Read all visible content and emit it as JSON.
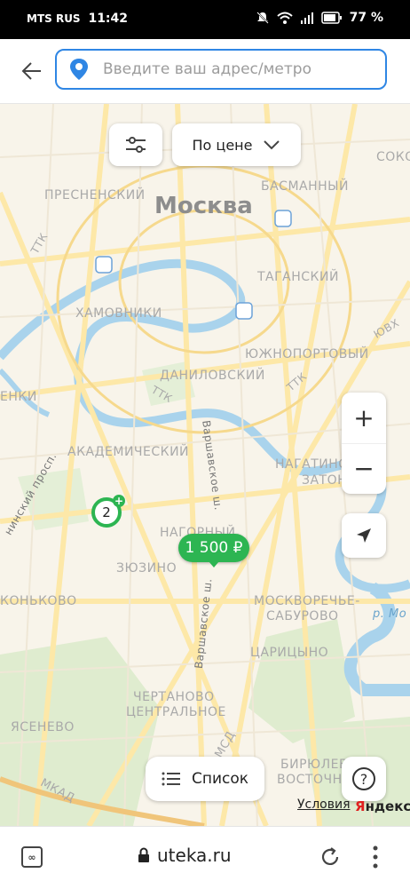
{
  "status": {
    "carrier": "MTS RUS",
    "time": "11:42",
    "battery": "77 %"
  },
  "search": {
    "placeholder": "Введите ваш адрес/метро"
  },
  "sort": {
    "label": "По цене"
  },
  "map": {
    "city": "Москва",
    "labels": {
      "presnensky": "ПРЕСНЕНСКИЙ",
      "basmanny": "БАСМАННЫЙ",
      "soko": "СОКО",
      "tagansky": "ТАГАНСКИЙ",
      "khamovniki": "ХАМОВНИКИ",
      "yuzhnoportovy": "ЮЖНОПОРТОВЫЙ",
      "danilovsky": "ДАНИЛОВСКИЙ",
      "akademichesky": "АКАДЕМИЧЕСКИЙ",
      "nagatino": "НАГАТИНО-",
      "zaton": "ЗАТОН",
      "nagorny": "НАГОРНЫЙ",
      "zyuzino": "ЗЮЗИНО",
      "konkovo": "КОНЬКОВО",
      "moskvorechye": "МОСКВОРЕЧЬЕ-",
      "saburovo": "САБУРОВО",
      "tsaritsyno": "ЦАРИЦЫНО",
      "chertanovo": "ЧЕРТАНОВО",
      "tsentralnoe": "ЦЕНТРАЛЬНОЕ",
      "yasenevo": "ЯСЕНЕВО",
      "biryulevo": "БИРЮЛЕВО",
      "vostochnoe": "ВОСТОЧНОЕ",
      "enki": "ЕНКИ",
      "ttk1": "ТТК",
      "ttk2": "ТТК",
      "ttk3": "ТТК",
      "yuvh": "ЮВХ",
      "mkad": "МКАД",
      "mcd": "МСД",
      "varsh1": "Варшавское ш.",
      "varsh2": "Варшавское ш.",
      "leninsky": "нинский просп.",
      "river": "р. Мо"
    },
    "cluster_count": "2",
    "price_pin": "1 500 ₽",
    "zoom_in": "+",
    "zoom_out": "−",
    "list_label": "Список",
    "help": "?",
    "terms": "Условия",
    "brand_y": "Я",
    "brand_rest": "ндекс"
  },
  "browser": {
    "url": "uteka.ru"
  },
  "colors": {
    "accent": "#2f86e4",
    "pin_green": "#2db552",
    "water": "#a9d3ec",
    "road": "#fde8a8"
  }
}
